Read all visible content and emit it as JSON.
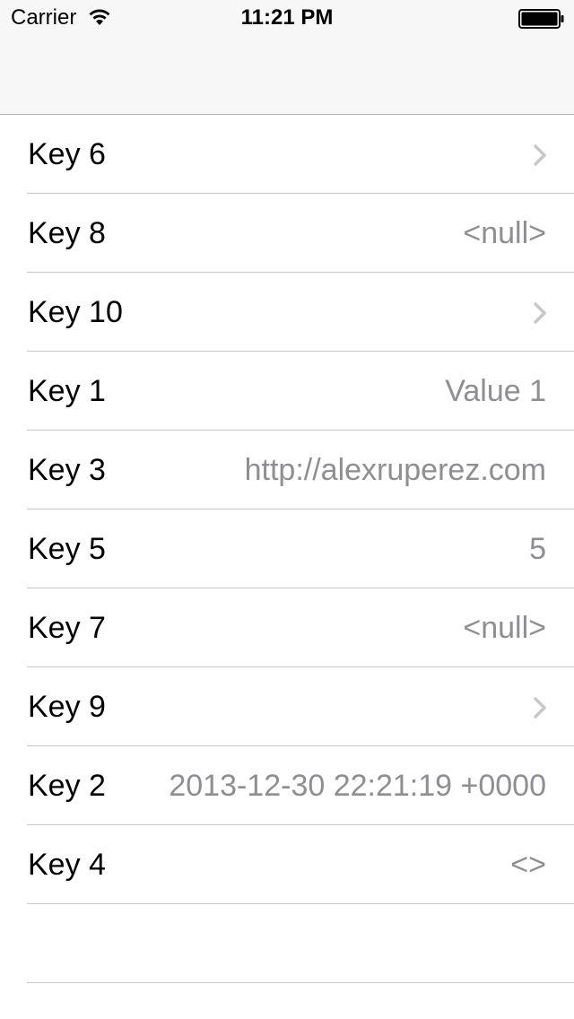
{
  "status_bar": {
    "carrier": "Carrier",
    "time": "11:21 PM",
    "wifi_icon": "wifi-icon",
    "battery_icon": "battery-icon"
  },
  "navigation_bar": {
    "title": ""
  },
  "table": {
    "rows": [
      {
        "key": "Key 6",
        "value": "",
        "accessory": "chevron-icon"
      },
      {
        "key": "Key 8",
        "value": "<null>",
        "accessory": ""
      },
      {
        "key": "Key 10",
        "value": "",
        "accessory": "chevron-icon"
      },
      {
        "key": "Key 1",
        "value": "Value 1",
        "accessory": ""
      },
      {
        "key": "Key 3",
        "value": "http://alexruperez.com",
        "accessory": ""
      },
      {
        "key": "Key 5",
        "value": "5",
        "accessory": ""
      },
      {
        "key": "Key 7",
        "value": "<null>",
        "accessory": ""
      },
      {
        "key": "Key 9",
        "value": "",
        "accessory": "chevron-icon"
      },
      {
        "key": "Key 2",
        "value": "2013-12-30 22:21:19 +0000",
        "accessory": ""
      },
      {
        "key": "Key 4",
        "value": "<>",
        "accessory": ""
      }
    ]
  },
  "colors": {
    "navbar_background": "#f7f7f7",
    "detail_text": "#8e8e93",
    "separator": "#c8c7cc",
    "chevron": "#c7c7cc"
  }
}
